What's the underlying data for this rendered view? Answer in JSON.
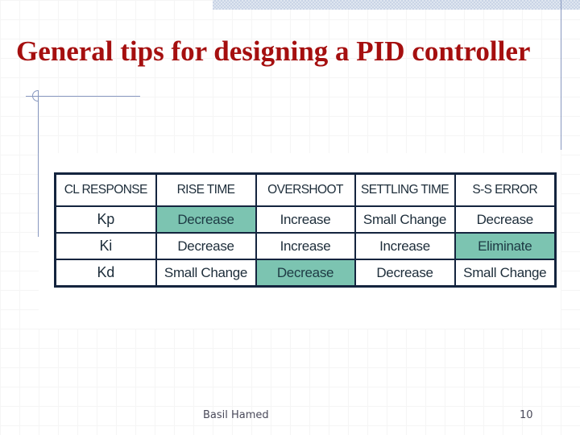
{
  "slide": {
    "title": "General tips for designing a PID controller",
    "footer": {
      "author": "Basil Hamed",
      "page_number": "10"
    },
    "colors": {
      "title": "#a50f0f",
      "highlight": "#7cc4b1",
      "table_border": "#14243e",
      "decoration": "#8898c0"
    }
  },
  "table": {
    "headers": [
      "CL RESPONSE",
      "RISE TIME",
      "OVERSHOOT",
      "SETTLING TIME",
      "S-S ERROR"
    ],
    "rows": [
      {
        "label": "Kp",
        "cells": [
          "Decrease",
          "Increase",
          "Small Change",
          "Decrease"
        ],
        "highlighted": [
          true,
          false,
          false,
          false
        ]
      },
      {
        "label": "Ki",
        "cells": [
          "Decrease",
          "Increase",
          "Increase",
          "Eliminate"
        ],
        "highlighted": [
          false,
          false,
          false,
          true
        ]
      },
      {
        "label": "Kd",
        "cells": [
          "Small Change",
          "Decrease",
          "Decrease",
          "Small Change"
        ],
        "highlighted": [
          false,
          true,
          false,
          false
        ]
      }
    ]
  }
}
